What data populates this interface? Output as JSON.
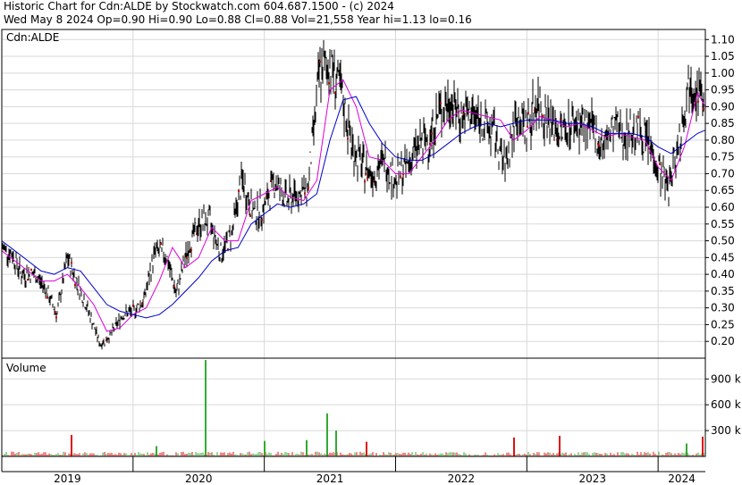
{
  "header": {
    "line1": "Historic Chart for Cdn:ALDE by Stockwatch.com 604.687.1500 - (c) 2024",
    "line2": "Wed May  8 2024  Op=0.90  Hi=0.90  Lo=0.88  Cl=0.88  Vol=21,558  Year hi=1.13  lo=0.16"
  },
  "price_panel": {
    "label": "Cdn:ALDE"
  },
  "volume_panel": {
    "label": "Volume"
  },
  "colors": {
    "price_bars": "#000000",
    "close_marker": "#cc0000",
    "ma_short": "#dd00dd",
    "ma_long": "#0000cc",
    "volume_up": "#33aa33",
    "volume_down": "#dd1111",
    "grid": "#d8d8d8",
    "frame": "#000000"
  },
  "chart_data": [
    {
      "type": "line",
      "title": "Cdn:ALDE",
      "y_axis_side": "right",
      "ylim": [
        0.15,
        1.13
      ],
      "y_ticks": [
        1.1,
        1.05,
        1.0,
        0.95,
        0.9,
        0.85,
        0.8,
        0.75,
        0.7,
        0.65,
        0.6,
        0.55,
        0.5,
        0.45,
        0.4,
        0.35,
        0.3,
        0.25,
        0.2
      ],
      "y_tick_labels": [
        "1.10",
        "1.05",
        "1.00",
        "0.95",
        "0.90",
        "0.85",
        "0.80",
        "0.75",
        "0.70",
        "0.65",
        "0.60",
        "0.55",
        "0.50",
        "0.45",
        "0.40",
        "0.35",
        "0.30",
        "0.25",
        "0.20"
      ],
      "x_range": [
        2019.0,
        2024.36
      ],
      "x_tick_labels": [
        "2019",
        "2020",
        "2021",
        "2022",
        "2023",
        "2024"
      ],
      "year_starts": [
        2019.0,
        2020.0,
        2021.0,
        2022.0,
        2023.0,
        2024.0
      ],
      "grid": true,
      "series": [
        {
          "key": "price",
          "style": "daily-range",
          "x": [
            2019.0,
            2019.08,
            2019.15,
            2019.25,
            2019.33,
            2019.42,
            2019.5,
            2019.58,
            2019.67,
            2019.75,
            2019.83,
            2019.92,
            2020.0,
            2020.08,
            2020.17,
            2020.25,
            2020.33,
            2020.42,
            2020.5,
            2020.58,
            2020.67,
            2020.75,
            2020.83,
            2020.92,
            2021.0,
            2021.08,
            2021.17,
            2021.25,
            2021.33,
            2021.42,
            2021.5,
            2021.58,
            2021.67,
            2021.75,
            2021.83,
            2021.92,
            2022.0,
            2022.08,
            2022.17,
            2022.25,
            2022.33,
            2022.42,
            2022.5,
            2022.58,
            2022.67,
            2022.75,
            2022.83,
            2022.92,
            2023.0,
            2023.08,
            2023.17,
            2023.25,
            2023.33,
            2023.42,
            2023.5,
            2023.58,
            2023.67,
            2023.75,
            2023.83,
            2023.92,
            2024.0,
            2024.08,
            2024.17,
            2024.25,
            2024.3,
            2024.36
          ],
          "y": [
            0.48,
            0.46,
            0.4,
            0.4,
            0.36,
            0.28,
            0.45,
            0.37,
            0.28,
            0.19,
            0.22,
            0.28,
            0.29,
            0.32,
            0.47,
            0.46,
            0.34,
            0.48,
            0.55,
            0.56,
            0.46,
            0.52,
            0.68,
            0.58,
            0.6,
            0.68,
            0.62,
            0.64,
            0.65,
            1.0,
            1.03,
            0.95,
            0.78,
            0.72,
            0.7,
            0.74,
            0.68,
            0.72,
            0.78,
            0.8,
            0.88,
            0.92,
            0.87,
            0.88,
            0.85,
            0.82,
            0.72,
            0.87,
            0.84,
            0.92,
            0.86,
            0.82,
            0.85,
            0.85,
            0.83,
            0.78,
            0.84,
            0.82,
            0.83,
            0.8,
            0.72,
            0.66,
            0.82,
            1.0,
            0.95,
            0.88
          ]
        },
        {
          "key": "ma_short",
          "x": [
            2019.0,
            2019.1,
            2019.2,
            2019.3,
            2019.4,
            2019.5,
            2019.6,
            2019.7,
            2019.8,
            2019.9,
            2020.0,
            2020.1,
            2020.2,
            2020.3,
            2020.4,
            2020.5,
            2020.6,
            2020.7,
            2020.8,
            2020.9,
            2021.0,
            2021.1,
            2021.2,
            2021.3,
            2021.4,
            2021.5,
            2021.6,
            2021.7,
            2021.8,
            2021.9,
            2022.0,
            2022.1,
            2022.2,
            2022.3,
            2022.4,
            2022.5,
            2022.6,
            2022.7,
            2022.8,
            2022.9,
            2023.0,
            2023.1,
            2023.2,
            2023.3,
            2023.4,
            2023.5,
            2023.6,
            2023.7,
            2023.8,
            2023.9,
            2024.0,
            2024.1,
            2024.2,
            2024.3,
            2024.36
          ],
          "y": [
            0.47,
            0.44,
            0.41,
            0.38,
            0.38,
            0.4,
            0.36,
            0.31,
            0.23,
            0.24,
            0.28,
            0.3,
            0.38,
            0.48,
            0.42,
            0.45,
            0.54,
            0.5,
            0.5,
            0.62,
            0.64,
            0.66,
            0.63,
            0.62,
            0.68,
            0.95,
            0.98,
            0.9,
            0.75,
            0.74,
            0.7,
            0.7,
            0.75,
            0.8,
            0.86,
            0.89,
            0.88,
            0.87,
            0.86,
            0.8,
            0.83,
            0.87,
            0.86,
            0.84,
            0.85,
            0.83,
            0.81,
            0.82,
            0.81,
            0.8,
            0.72,
            0.68,
            0.78,
            0.94,
            0.9
          ]
        },
        {
          "key": "ma_long",
          "x": [
            2019.0,
            2019.1,
            2019.2,
            2019.3,
            2019.4,
            2019.5,
            2019.6,
            2019.7,
            2019.8,
            2019.9,
            2020.0,
            2020.1,
            2020.2,
            2020.3,
            2020.4,
            2020.5,
            2020.6,
            2020.7,
            2020.8,
            2020.9,
            2021.0,
            2021.1,
            2021.2,
            2021.3,
            2021.4,
            2021.5,
            2021.6,
            2021.7,
            2021.8,
            2021.9,
            2022.0,
            2022.1,
            2022.2,
            2022.3,
            2022.4,
            2022.5,
            2022.6,
            2022.7,
            2022.8,
            2022.9,
            2023.0,
            2023.1,
            2023.2,
            2023.3,
            2023.4,
            2023.5,
            2023.6,
            2023.7,
            2023.8,
            2023.9,
            2024.0,
            2024.1,
            2024.2,
            2024.3,
            2024.36
          ],
          "y": [
            0.5,
            0.47,
            0.44,
            0.41,
            0.4,
            0.42,
            0.41,
            0.36,
            0.31,
            0.29,
            0.28,
            0.27,
            0.28,
            0.31,
            0.35,
            0.39,
            0.44,
            0.47,
            0.48,
            0.55,
            0.58,
            0.61,
            0.6,
            0.61,
            0.64,
            0.8,
            0.92,
            0.93,
            0.85,
            0.79,
            0.75,
            0.74,
            0.74,
            0.76,
            0.79,
            0.82,
            0.84,
            0.85,
            0.84,
            0.85,
            0.86,
            0.86,
            0.86,
            0.85,
            0.85,
            0.84,
            0.82,
            0.82,
            0.82,
            0.81,
            0.78,
            0.76,
            0.79,
            0.82,
            0.83
          ]
        }
      ]
    },
    {
      "type": "bar",
      "title": "Volume",
      "y_axis_side": "right",
      "ylim": [
        0,
        1100000
      ],
      "y_ticks": [
        300000,
        600000,
        900000
      ],
      "y_tick_labels": [
        "300 k",
        "600 k",
        "900 k"
      ],
      "x_range": [
        2019.0,
        2024.36
      ],
      "spikes": {
        "x": [
          2019.53,
          2020.18,
          2020.55,
          2021.0,
          2021.32,
          2021.48,
          2021.55,
          2021.78,
          2022.9,
          2023.25,
          2024.22,
          2024.34
        ],
        "values": [
          250000,
          120000,
          1120000,
          180000,
          190000,
          500000,
          300000,
          170000,
          220000,
          240000,
          150000,
          230000
        ],
        "up": [
          false,
          true,
          true,
          true,
          true,
          true,
          true,
          false,
          false,
          false,
          true,
          false
        ]
      }
    }
  ]
}
